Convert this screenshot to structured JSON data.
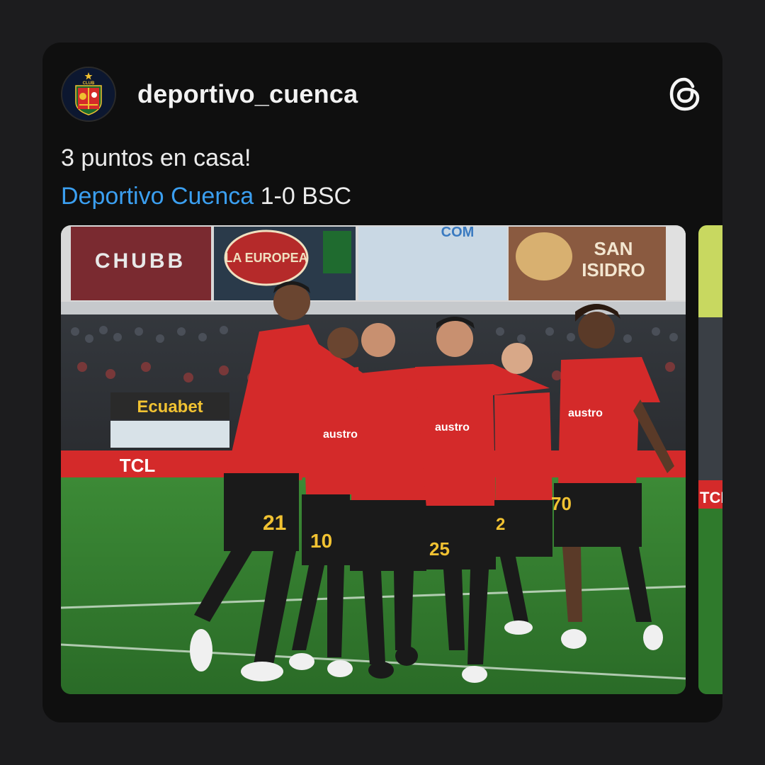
{
  "post": {
    "username": "deportivo_cuenca",
    "caption_line1": "3 puntos en casa!",
    "mention": "Deportivo Cuenca",
    "score_text": " 1-0 BSC"
  },
  "icons": {
    "platform": "threads-icon",
    "avatar": "club-crest-avatar"
  },
  "photo": {
    "banners": [
      "CHUBB",
      "LA EUROPEA",
      "SAN ISIDRO",
      "Ecuabet",
      "TCL"
    ],
    "sponsor_shirt": "austro",
    "numbers": [
      "21",
      "10",
      "25",
      "2",
      "70"
    ]
  },
  "colors": {
    "background": "#1c1c1e",
    "card": "#0f0f0f",
    "mention": "#3b9ff0",
    "jersey": "#d42a2a",
    "pitch": "#2f7a2c"
  }
}
